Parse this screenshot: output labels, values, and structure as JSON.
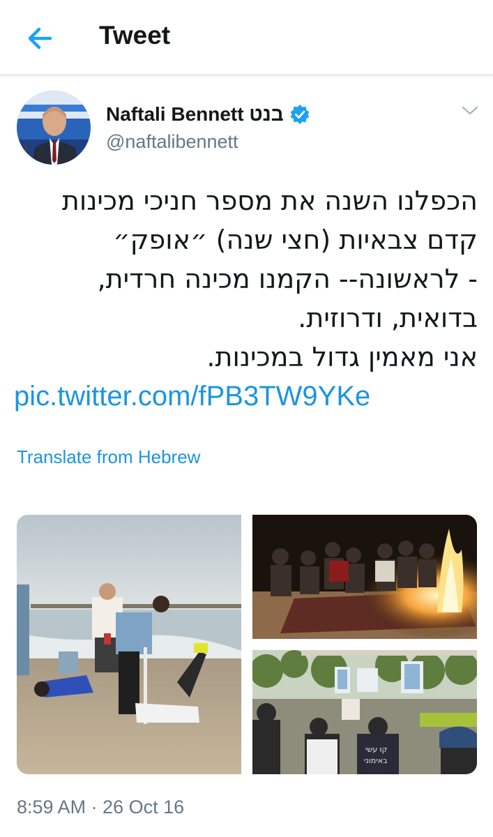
{
  "header": {
    "title": "Tweet",
    "back_icon": "arrow-left-icon",
    "accent_color": "#1da1f2"
  },
  "tweet": {
    "author": {
      "display_name": "Naftali Bennett בנט",
      "handle": "@naftalibennett",
      "verified": true
    },
    "text_lines": [
      "הכפלנו השנה את מספר חניכי מכינות",
      "קדם צבאיות (חצי שנה) ״אופק״",
      "- לראשונה-- הקמנו מכינה חרדית,",
      "בדואית, ודרוזית.",
      "אני מאמין גדול במכינות."
    ],
    "link": "pic.twitter.com/fPB3TW9YKe",
    "translate_label": "Translate from Hebrew",
    "timestamp": "8:59 AM · 26 Oct 16",
    "link_color": "#1b95e0"
  },
  "photo_overlays": {
    "shirt_text_line1": "קוּ עשי",
    "shirt_text_line2": "באימוני"
  }
}
